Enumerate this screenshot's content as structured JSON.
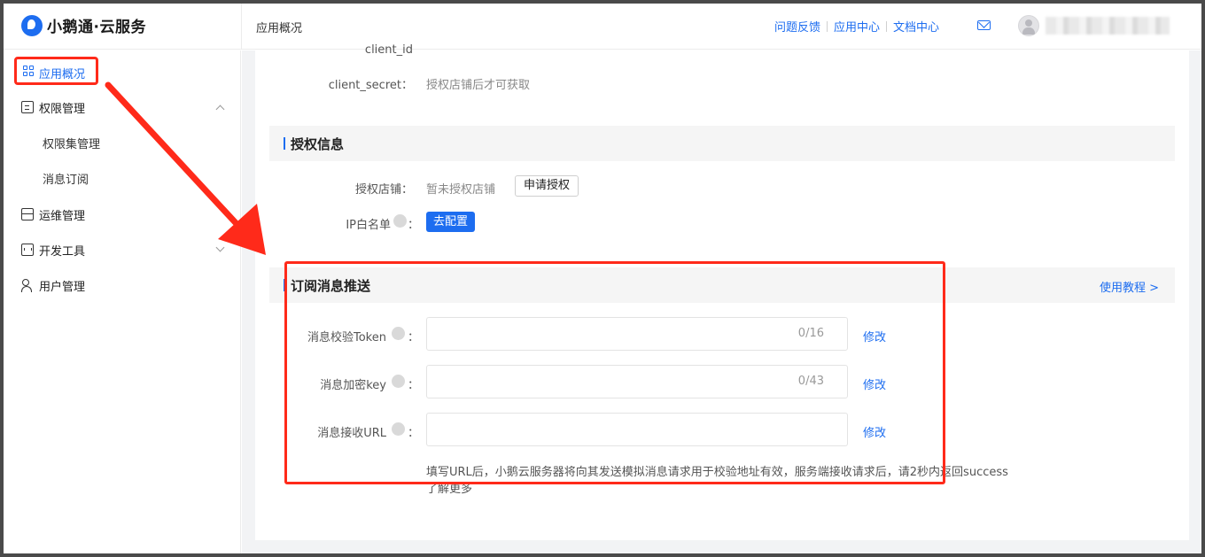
{
  "header": {
    "brand": "小鹅通·云服务",
    "page_title": "应用概况",
    "links": [
      "问题反馈",
      "应用中心",
      "文档中心"
    ]
  },
  "sidebar": {
    "items": [
      {
        "label": "应用概况",
        "active": true
      },
      {
        "label": "权限管理",
        "expanded": true,
        "children": [
          "权限集管理",
          "消息订阅"
        ]
      },
      {
        "label": "运维管理"
      },
      {
        "label": "开发工具",
        "expanded": false
      },
      {
        "label": "用户管理"
      }
    ]
  },
  "app_info": {
    "client_id_label": "client_id",
    "client_secret_label": "client_secret",
    "client_secret_value": "授权店铺后才可获取"
  },
  "auth_section": {
    "title": "授权信息",
    "shop_label": "授权店铺",
    "shop_value": "暂未授权店铺",
    "apply_button": "申请授权",
    "ip_label": "IP白名单",
    "config_button": "去配置"
  },
  "subscribe_section": {
    "title": "订阅消息推送",
    "tutorial_link": "使用教程 >",
    "fields": [
      {
        "label": "消息校验Token",
        "value": "",
        "count": "0/16",
        "action": "修改"
      },
      {
        "label": "消息加密key",
        "value": "",
        "count": "0/43",
        "action": "修改"
      },
      {
        "label": "消息接收URL",
        "value": "",
        "count": "",
        "action": "修改"
      }
    ],
    "note": "填写URL后，小鹅云服务器将向其发送模拟消息请求用于校验地址有效，服务端接收请求后，请2秒内返回success",
    "learn_more": "了解更多"
  },
  "colors": {
    "primary": "#1d6df0",
    "annotation": "#ff2a1a"
  }
}
